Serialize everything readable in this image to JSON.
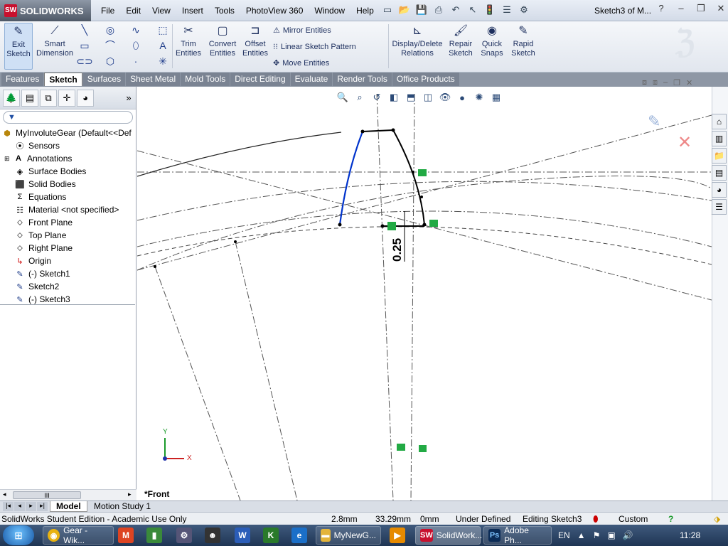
{
  "app": {
    "logo_text": "SOLIDWORKS",
    "doc_title": "Sketch3 of M..."
  },
  "menu": [
    "File",
    "Edit",
    "View",
    "Insert",
    "Tools",
    "PhotoView 360",
    "Window",
    "Help"
  ],
  "toolbar": {
    "exit_sketch": "Exit\nSketch",
    "smart_dimension": "Smart\nDimension",
    "trim": "Trim\nEntities",
    "convert": "Convert\nEntities",
    "offset": "Offset\nEntities",
    "mirror": "Mirror Entities",
    "linear_pattern": "Linear Sketch Pattern",
    "move": "Move Entities",
    "display_delete": "Display/Delete\nRelations",
    "repair": "Repair\nSketch",
    "quick_snaps": "Quick\nSnaps",
    "rapid": "Rapid\nSketch"
  },
  "tabs": [
    "Features",
    "Sketch",
    "Surfaces",
    "Sheet Metal",
    "Mold Tools",
    "Direct Editing",
    "Evaluate",
    "Render Tools",
    "Office Products"
  ],
  "active_tab": "Sketch",
  "tree": {
    "root": "MyInvoluteGear  (Default<<Def",
    "items": [
      "Sensors",
      "Annotations",
      "Surface Bodies",
      "Solid Bodies",
      "Equations",
      "Material <not specified>",
      "Front Plane",
      "Top Plane",
      "Right Plane",
      "Origin",
      "(-) Sketch1",
      "Sketch2",
      "(-) Sketch3"
    ]
  },
  "graphics": {
    "view_name": "*Front",
    "dimension": "0.25",
    "triad_y": "Y",
    "triad_x": "X"
  },
  "bottom_tabs": [
    "Model",
    "Motion Study 1"
  ],
  "status": {
    "edition": "SolidWorks Student Edition - Academic Use Only",
    "x": "2.8mm",
    "y": "33.29mm",
    "z": "0mm",
    "state": "Under Defined",
    "editing": "Editing Sketch3",
    "units": "Custom"
  },
  "taskbar": {
    "items": [
      "Gear - Wik...",
      "MyNewG...",
      "SolidWork...",
      "Adobe Ph..."
    ],
    "lang": "EN",
    "time": "11:28"
  },
  "colors": {
    "accent": "#1f3d8a",
    "sketch_blue": "#0033cc",
    "relation_green": "#22aa44"
  }
}
